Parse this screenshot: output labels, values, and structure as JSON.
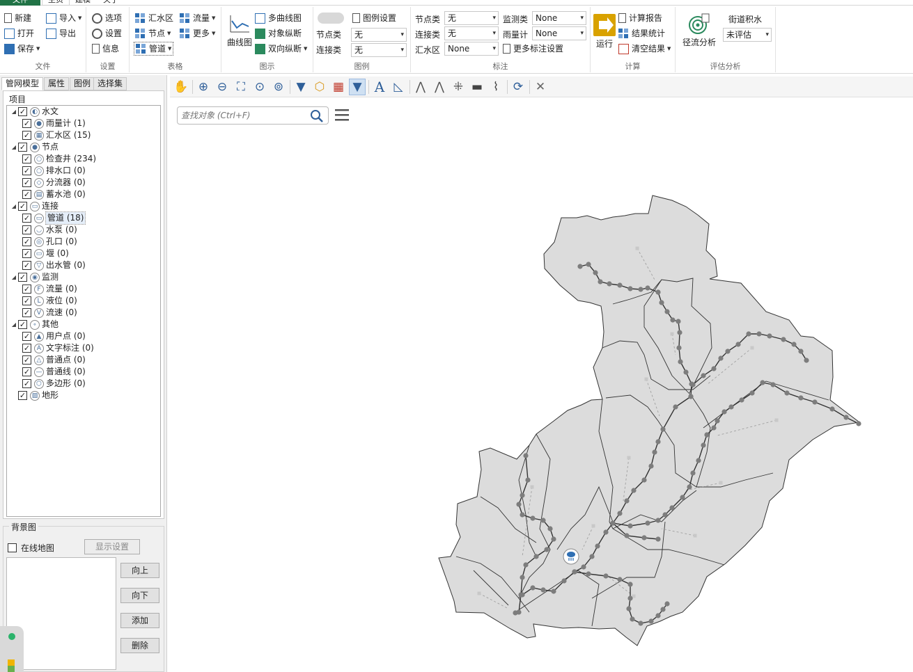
{
  "menu": {
    "file": "文件",
    "home": "主页",
    "model": "建模",
    "about": "关于"
  },
  "ribbon": {
    "file": {
      "label": "文件",
      "new": "新建",
      "open": "打开",
      "save": "保存",
      "import": "导入",
      "export": "导出"
    },
    "settings": {
      "label": "设置",
      "options": "选项",
      "settings": "设置",
      "info": "信息"
    },
    "table": {
      "label": "表格",
      "catchment": "汇水区",
      "node": "节点",
      "pipe": "管道",
      "flow": "流量",
      "more": "更多"
    },
    "graph": {
      "label": "图示",
      "curve": "曲线图",
      "multi_curve": "多曲线图",
      "object_profile": "对象纵断",
      "bidir_profile": "双向纵断"
    },
    "legend": {
      "label": "图例",
      "legend_settings": "图例设置",
      "node_class_label": "节点类",
      "node_class_value": "无",
      "link_class_label": "连接类",
      "link_class_value": "无"
    },
    "annotation": {
      "label": "标注",
      "node_class_label": "节点类",
      "node_class_value": "无",
      "link_class_label": "连接类",
      "link_class_value": "无",
      "catchment_label": "汇水区",
      "catchment_value": "None",
      "monitor_label": "监测类",
      "monitor_value": "None",
      "raingauge_label": "雨量计",
      "raingauge_value": "None",
      "more_settings": "更多标注设置"
    },
    "compute": {
      "label": "计算",
      "run": "运行",
      "report": "计算报告",
      "stats": "结果统计",
      "clear": "清空结果"
    },
    "evaluate": {
      "label": "评估分析",
      "runoff": "径流分析",
      "street_water_label": "街道积水",
      "street_water_value": "未评估"
    }
  },
  "panel_tabs": [
    "管网模型",
    "属性",
    "图例",
    "选择集"
  ],
  "tree": {
    "header": "项目",
    "items": [
      {
        "label": "水文",
        "icon": "hydrology-icon"
      },
      {
        "label": "雨量计 (1)",
        "icon": "raingauge-icon"
      },
      {
        "label": "汇水区 (15)",
        "icon": "catchment-icon"
      },
      {
        "label": "节点",
        "icon": "node-icon"
      },
      {
        "label": "检查井 (234)",
        "icon": "manhole-icon"
      },
      {
        "label": "排水口 (0)",
        "icon": "outfall-icon"
      },
      {
        "label": "分流器 (0)",
        "icon": "divider-icon"
      },
      {
        "label": "蓄水池 (0)",
        "icon": "storage-icon"
      },
      {
        "label": "连接",
        "icon": "link-icon"
      },
      {
        "label": "管道 (18)",
        "icon": "pipe-icon"
      },
      {
        "label": "水泵 (0)",
        "icon": "pump-icon"
      },
      {
        "label": "孔口 (0)",
        "icon": "orifice-icon"
      },
      {
        "label": "堰 (0)",
        "icon": "weir-icon"
      },
      {
        "label": "出水管 (0)",
        "icon": "outlet-icon"
      },
      {
        "label": "监测",
        "icon": "monitor-icon"
      },
      {
        "label": "流量 (0)",
        "icon": "flow-icon"
      },
      {
        "label": "液位 (0)",
        "icon": "level-icon"
      },
      {
        "label": "流速 (0)",
        "icon": "velocity-icon"
      },
      {
        "label": "其他",
        "icon": "other-icon"
      },
      {
        "label": "用户点 (0)",
        "icon": "user-point-icon"
      },
      {
        "label": "文字标注 (0)",
        "icon": "text-label-icon"
      },
      {
        "label": "普通点 (0)",
        "icon": "point-icon"
      },
      {
        "label": "普通线 (0)",
        "icon": "line-icon"
      },
      {
        "label": "多边形 (0)",
        "icon": "polygon-icon"
      },
      {
        "label": "地形",
        "icon": "terrain-icon"
      }
    ]
  },
  "background": {
    "title": "背景图",
    "online_map": "在线地图",
    "display_settings": "显示设置",
    "up": "向上",
    "down": "向下",
    "add": "添加",
    "delete": "删除"
  },
  "search": {
    "placeholder": "查找对象 (Ctrl+F)"
  },
  "colors": {
    "ribbon_accent": "#217346",
    "icon_blue": "#2f6fb3",
    "catchment_fill": "#dcdcdc",
    "node_gray": "#7d7d7d"
  }
}
